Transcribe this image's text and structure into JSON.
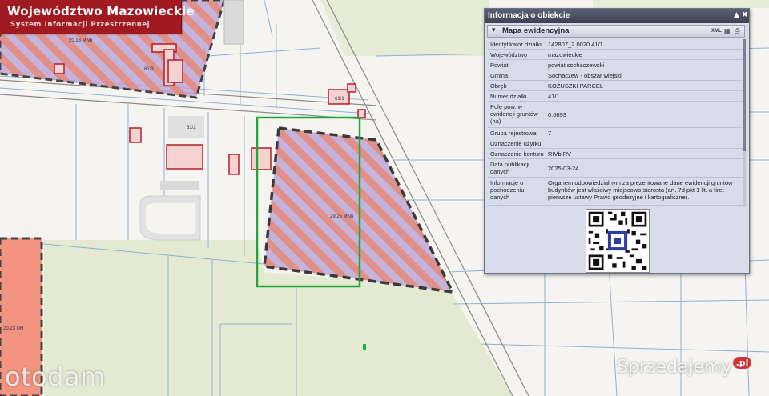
{
  "banner": {
    "title": "Województwo Mazowieckie",
    "subtitle": "System Informacji Przestrzennej"
  },
  "map": {
    "parcel_labels": [
      "61/2",
      "61/3",
      "61/1"
    ],
    "zone_labels": [
      "20.13 MNu",
      "29.25 MNu",
      "20.23 UH"
    ]
  },
  "panel": {
    "title": "Informacja o obiekcie",
    "section_title": "Mapa ewidencyjna",
    "section_toggle": "▾",
    "xml_label": "XML",
    "rows": [
      {
        "label": "Identyfikator działki",
        "value": "142807_2.0020.41/1"
      },
      {
        "label": "Województwo",
        "value": "mazowieckie"
      },
      {
        "label": "Powiat",
        "value": "powiat sochaczewski"
      },
      {
        "label": "Gmina",
        "value": "Sochaczew - obszar wiejski"
      },
      {
        "label": "Obręb",
        "value": "KOŻUSZKI PARCEL"
      },
      {
        "label": "Numer działki",
        "value": "41/1"
      },
      {
        "label": "Pole pow. w ewidencji gruntów (ha)",
        "value": "0.6693"
      },
      {
        "label": "Grupa rejestrowa",
        "value": "7"
      },
      {
        "label": "Oznaczenie użytku",
        "value": ""
      },
      {
        "label": "Oznaczenie konturu",
        "value": "RIVb,RV"
      },
      {
        "label": "Data publikacji danych",
        "value": "2025-03-24"
      },
      {
        "label": "Informacje o pochodzeniu danych",
        "value": "Organem odpowiedzialnym za prezentowane dane ewidencji gruntów i budynków jest właściwy miejscowo starosta (art. 7d pkt 1 lit. a tiret pierwsze ustawy Prawo geodezyjne i kartograficzne)."
      }
    ]
  },
  "watermarks": {
    "otodom": "otodam",
    "sprzedajemy": "Sprzedajemy",
    "sprzedajemy_tld": ".pl"
  },
  "colors": {
    "banner": "#a11a22",
    "parcel_highlight": "#1fa83a",
    "zone_stripe_a": "#e58a7a",
    "zone_stripe_b": "#b9a3d6"
  },
  "icons": {
    "minimize": "minimize-icon",
    "close": "close-icon",
    "print": "print-icon",
    "table": "table-icon"
  }
}
